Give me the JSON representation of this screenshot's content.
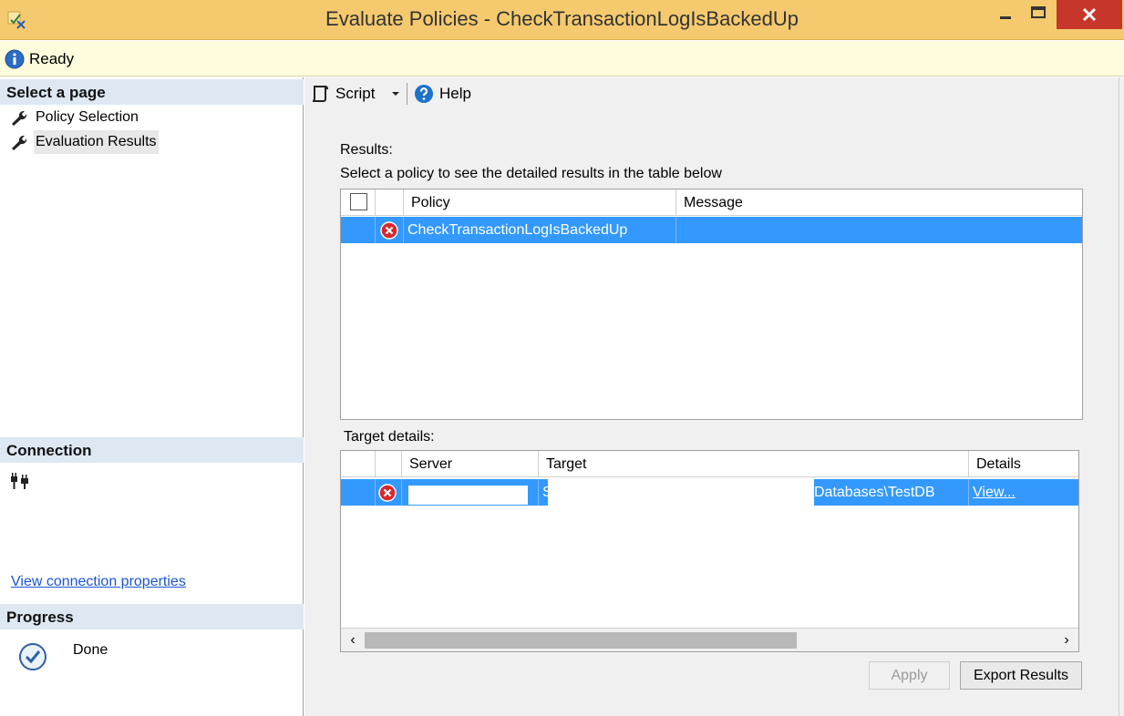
{
  "window": {
    "title": "Evaluate Policies - CheckTransactionLogIsBackedUp",
    "minimize_icon": "minimize-icon",
    "maximize_icon": "maximize-icon",
    "close_icon": "close-icon"
  },
  "status": {
    "text": "Ready",
    "icon": "info-icon"
  },
  "sidebar": {
    "select_page_header": "Select a page",
    "items": [
      {
        "label": "Policy Selection",
        "icon": "wrench-icon",
        "selected": false
      },
      {
        "label": "Evaluation Results",
        "icon": "wrench-icon",
        "selected": true
      }
    ],
    "connection_header": "Connection",
    "connection_icon": "connection-plug-icon",
    "view_connection_link": "View connection properties",
    "progress_header": "Progress",
    "progress_status": "Done",
    "progress_icon": "checkmark-icon"
  },
  "toolbar": {
    "script_label": "Script",
    "help_label": "Help"
  },
  "results": {
    "label": "Results:",
    "hint": "Select a policy to see the detailed results in the table below",
    "columns": [
      "Policy",
      "Message"
    ],
    "rows": [
      {
        "policy": "CheckTransactionLogIsBackedUp",
        "message": "",
        "status": "error"
      }
    ]
  },
  "target_details": {
    "label": "Target details:",
    "columns": [
      "Server",
      "Target",
      "Details"
    ],
    "rows": [
      {
        "server": "",
        "target_start": "S",
        "target_end": "Databases\\TestDB",
        "details": "View...",
        "status": "error"
      }
    ]
  },
  "buttons": {
    "apply": "Apply",
    "export": "Export Results"
  },
  "colors": {
    "titlebar": "#f5ca6e",
    "selection": "#3399ff",
    "close_button": "#c7362b",
    "error": "#d9262d"
  }
}
